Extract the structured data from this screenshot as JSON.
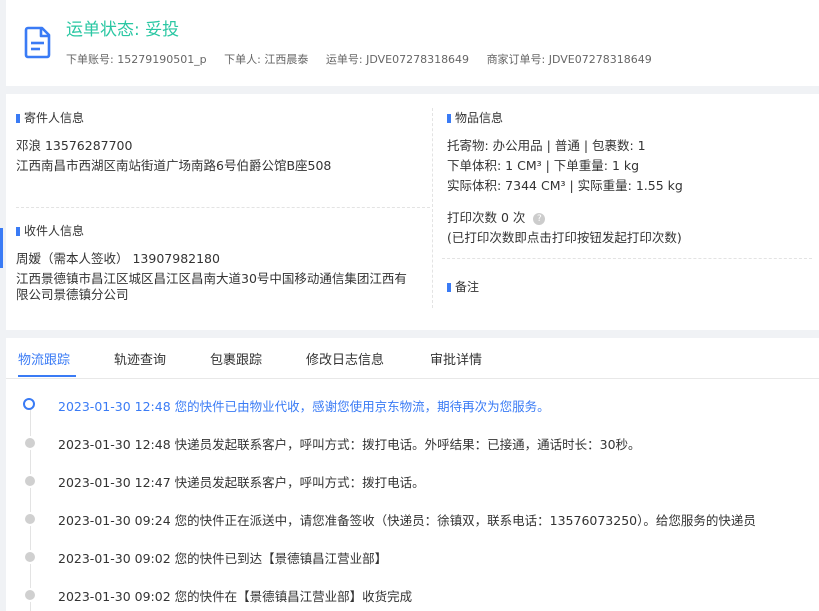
{
  "header": {
    "title": "运单状态: 妥投",
    "order_account": "下单账号: 15279190501_p",
    "orderer": "下单人: 江西晨泰",
    "waybill_no": "运单号: JDVE07278318649",
    "merchant_order_no": "商家订单号: JDVE07278318649"
  },
  "sender": {
    "section_title": "寄件人信息",
    "name_phone": "邓浪   13576287700",
    "address": "江西南昌市西湖区南站街道广场南路6号伯爵公馆B座508"
  },
  "receiver": {
    "section_title": "收件人信息",
    "name_phone": "周嫒（需本人签收）   13907982180",
    "address": "江西景德镇市昌江区城区昌江区昌南大道30号中国移动通信集团江西有限公司景德镇分公司"
  },
  "goods": {
    "section_title": "物品信息",
    "line1": "托寄物:  办公用品 | 普通  | 包裹数:  1",
    "line2": "下单体积:   1 CM³ | 下单重量:   1 kg",
    "line3": "实际体积:   7344 CM³ | 实际重量:   1.55 kg",
    "print_count": "打印次数    0 次",
    "print_note": "(已打印次数即点击打印按钮发起打印次数)"
  },
  "remark": {
    "section_title": "备注"
  },
  "tabs": [
    "物流跟踪",
    "轨迹查询",
    "包裹跟踪",
    "修改日志信息",
    "审批详情"
  ],
  "timeline": [
    {
      "time": "2023-01-30 12:48",
      "text": "您的快件已由物业代收，感谢您使用京东物流，期待再次为您服务。"
    },
    {
      "time": "2023-01-30 12:48",
      "text": "快递员发起联系客户，呼叫方式：拨打电话。外呼结果：已接通，通话时长：30秒。"
    },
    {
      "time": "2023-01-30 12:47",
      "text": "快递员发起联系客户，呼叫方式：拨打电话。"
    },
    {
      "time": "2023-01-30 09:24",
      "text": "您的快件正在派送中，请您准备签收（快递员：徐镇双，联系电话：13576073250）。给您服务的快递员"
    },
    {
      "time": "2023-01-30 09:02",
      "text": "您的快件已到达【景德镇昌江营业部】"
    },
    {
      "time": "2023-01-30 09:02",
      "text": "您的快件在【景德镇昌江营业部】收货完成"
    }
  ],
  "colors": {
    "accent": "#3a7bf5",
    "status_green": "#2ac7a3"
  }
}
